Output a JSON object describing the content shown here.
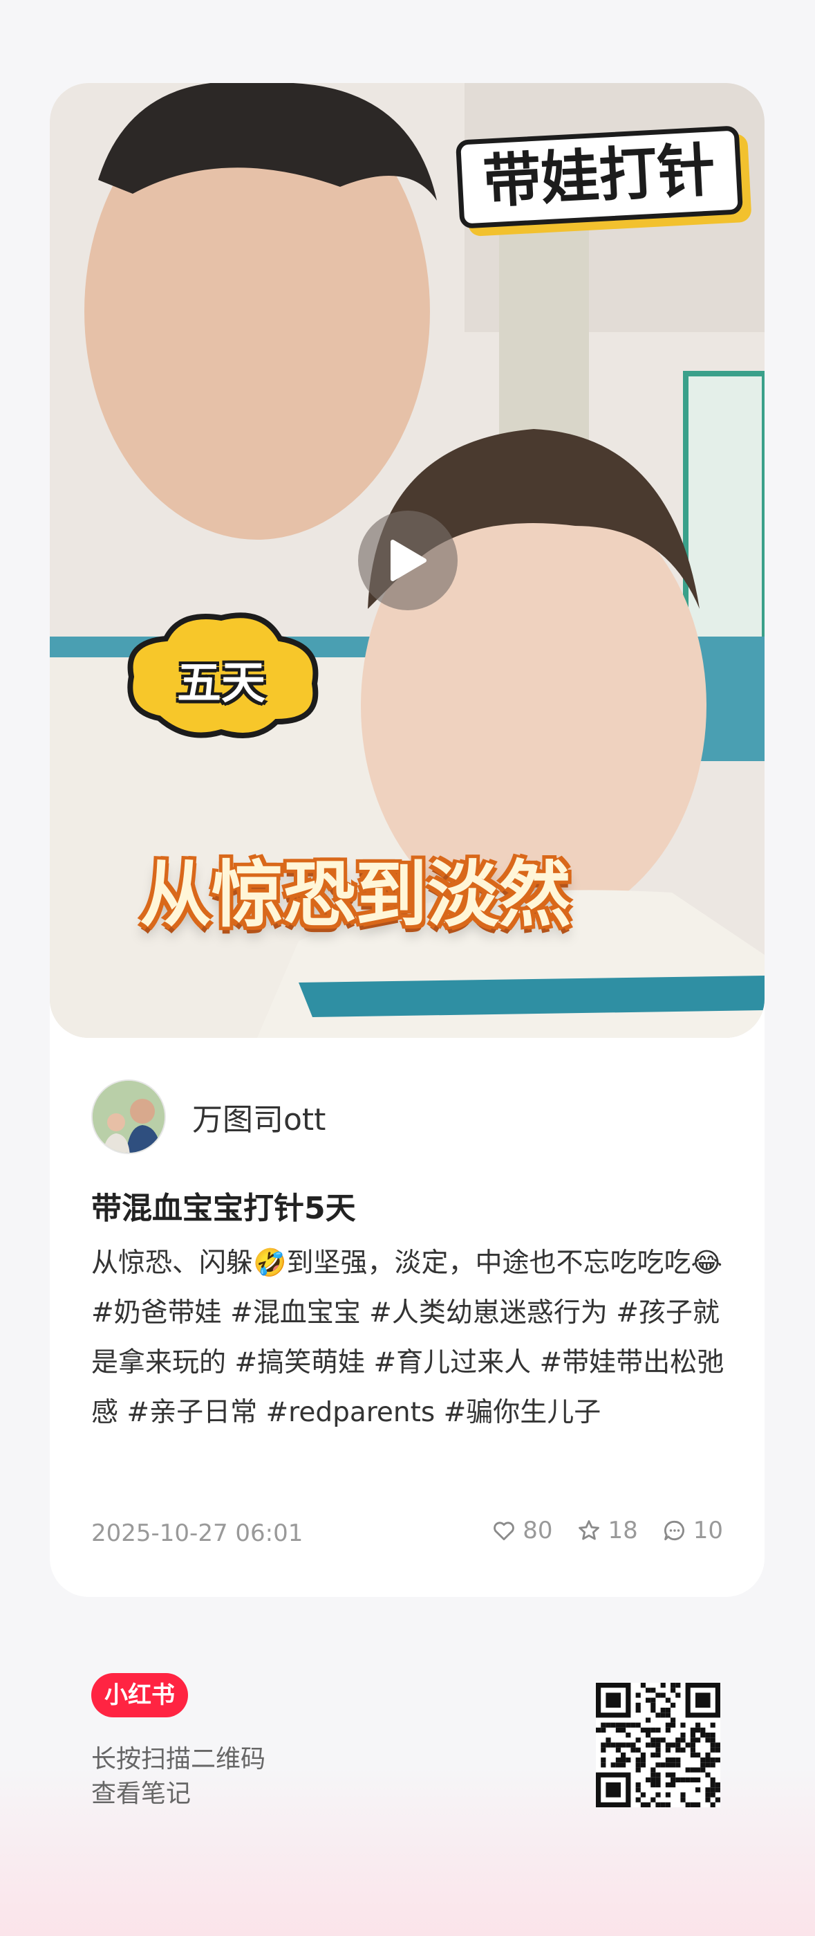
{
  "post": {
    "sticker_top": "带娃打针",
    "sticker_cloud": "五天",
    "sticker_bottom": "从惊恐到淡然",
    "author_name": "万图司ott",
    "title": "带混血宝宝打针5天",
    "description": "从惊恐、闪躲🤣到坚强，淡定，中途也不忘吃吃吃😂#奶爸带娃 #混血宝宝 #人类幼崽迷惑行为 #孩子就是拿来玩的 #搞笑萌娃 #育儿过来人 #带娃带出松弛感 #亲子日常 #redparents #骗你生儿子",
    "date": "2025-10-27 06:01",
    "likes": "80",
    "stars": "18",
    "comments": "10"
  },
  "footer": {
    "brand": "小红书",
    "scan_line1": "长按扫描二维码",
    "scan_line2": "查看笔记"
  },
  "icons": {
    "play": "play-icon",
    "like": "heart-icon",
    "star": "star-icon",
    "comment": "comment-icon"
  },
  "colors": {
    "brand": "#ff2442",
    "background": "#f6f6f8",
    "meta_text": "#999999"
  }
}
